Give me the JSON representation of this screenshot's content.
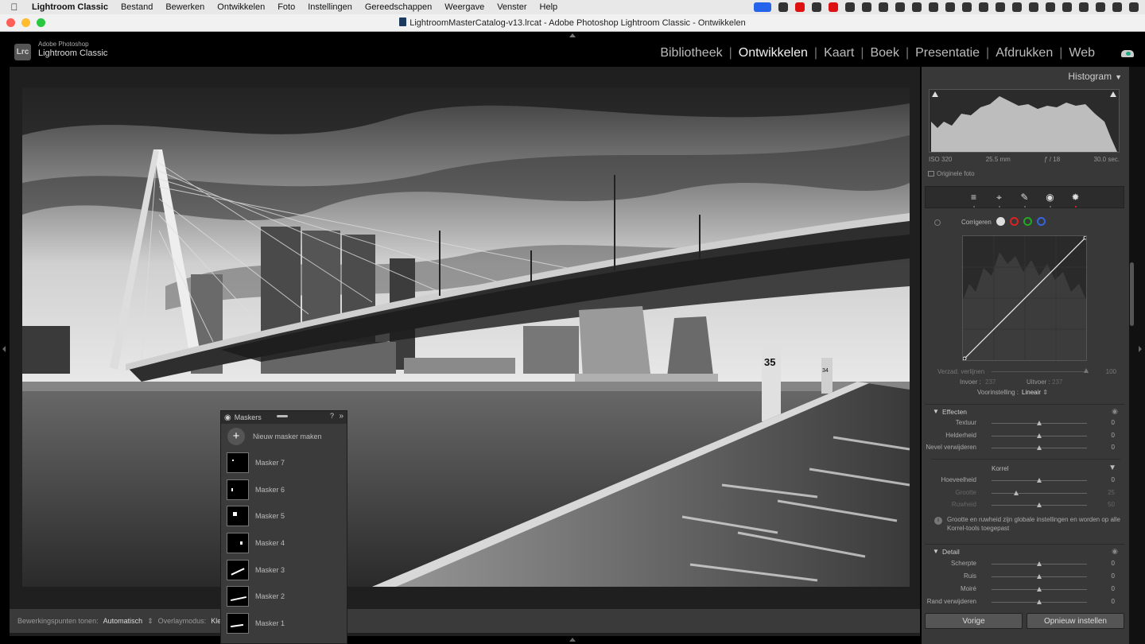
{
  "menubar": {
    "app_name": "Lightroom Classic",
    "items": [
      "Bestand",
      "Bewerken",
      "Ontwikkelen",
      "Foto",
      "Instellingen",
      "Gereedschappen",
      "Weergave",
      "Venster",
      "Help"
    ]
  },
  "window": {
    "title": "LightroomMasterCatalog-v13.lrcat - Adobe Photoshop Lightroom Classic - Ontwikkelen"
  },
  "brand": {
    "logo_text": "Lrc",
    "line1": "Adobe Photoshop",
    "line2": "Lightroom Classic"
  },
  "modules": [
    {
      "label": "Bibliotheek",
      "active": false
    },
    {
      "label": "Ontwikkelen",
      "active": true
    },
    {
      "label": "Kaart",
      "active": false
    },
    {
      "label": "Boek",
      "active": false
    },
    {
      "label": "Presentatie",
      "active": false
    },
    {
      "label": "Afdrukken",
      "active": false
    },
    {
      "label": "Web",
      "active": false
    }
  ],
  "toolbar": {
    "pins_label": "Bewerkingspunten tonen:",
    "pins_value": "Automatisch",
    "overlay_label": "Overlaymodus:",
    "overlay_value": "Kleuro"
  },
  "photo": {
    "pier_sign": "35",
    "pier_sign_small": "34"
  },
  "masks_panel": {
    "title": "Maskers",
    "new_mask_label": "Nieuw masker maken",
    "masks": [
      "Masker 7",
      "Masker 6",
      "Masker 5",
      "Masker 4",
      "Masker 3",
      "Masker 2",
      "Masker 1"
    ]
  },
  "histogram": {
    "title": "Histogram",
    "iso": "ISO 320",
    "focal": "25.5 mm",
    "aperture": "ƒ / 18",
    "shutter": "30.0 sec.",
    "original_label": "Originele foto"
  },
  "tone_curve": {
    "correct_label": "Corrigeren",
    "channels": [
      {
        "name": "rgb",
        "color": "#d8d8d8"
      },
      {
        "name": "red",
        "color": "#d22"
      },
      {
        "name": "green",
        "color": "#2a2"
      },
      {
        "name": "blue",
        "color": "#36d"
      }
    ],
    "saturation_label": "Verzad. verlijnen",
    "saturation_value": "100",
    "input_label": "Invoer :",
    "input_value": "237",
    "output_label": "Uitvoer :",
    "output_value": "237",
    "preset_label": "Voorinstelling :",
    "preset_value": "Lineair"
  },
  "effects": {
    "title": "Effecten",
    "sliders": [
      {
        "label": "Textuur",
        "value": "0",
        "level": 0.5
      },
      {
        "label": "Helderheid",
        "value": "0",
        "level": 0.5
      },
      {
        "label": "Nevel verwijderen",
        "value": "0",
        "level": 0.5
      }
    ],
    "grain_title": "Korrel",
    "grain_sliders": [
      {
        "label": "Hoeveelheid",
        "value": "0",
        "level": 0.5,
        "dim": false
      },
      {
        "label": "Grootte",
        "value": "25",
        "level": 0.25,
        "dim": true
      },
      {
        "label": "Ruwheid",
        "value": "50",
        "level": 0.5,
        "dim": true
      }
    ],
    "note": "Grootte en ruwheid zijn globale instellingen en worden op alle Korrel-tools toegepast"
  },
  "detail": {
    "title": "Detail",
    "sliders": [
      {
        "label": "Scherpte",
        "value": "0",
        "level": 0.5
      },
      {
        "label": "Ruis",
        "value": "0",
        "level": 0.5
      },
      {
        "label": "Moiré",
        "value": "0",
        "level": 0.5
      },
      {
        "label": "Rand verwijderen",
        "value": "0",
        "level": 0.5
      }
    ]
  },
  "buttons": {
    "previous": "Vorige",
    "reset": "Opnieuw instellen"
  }
}
